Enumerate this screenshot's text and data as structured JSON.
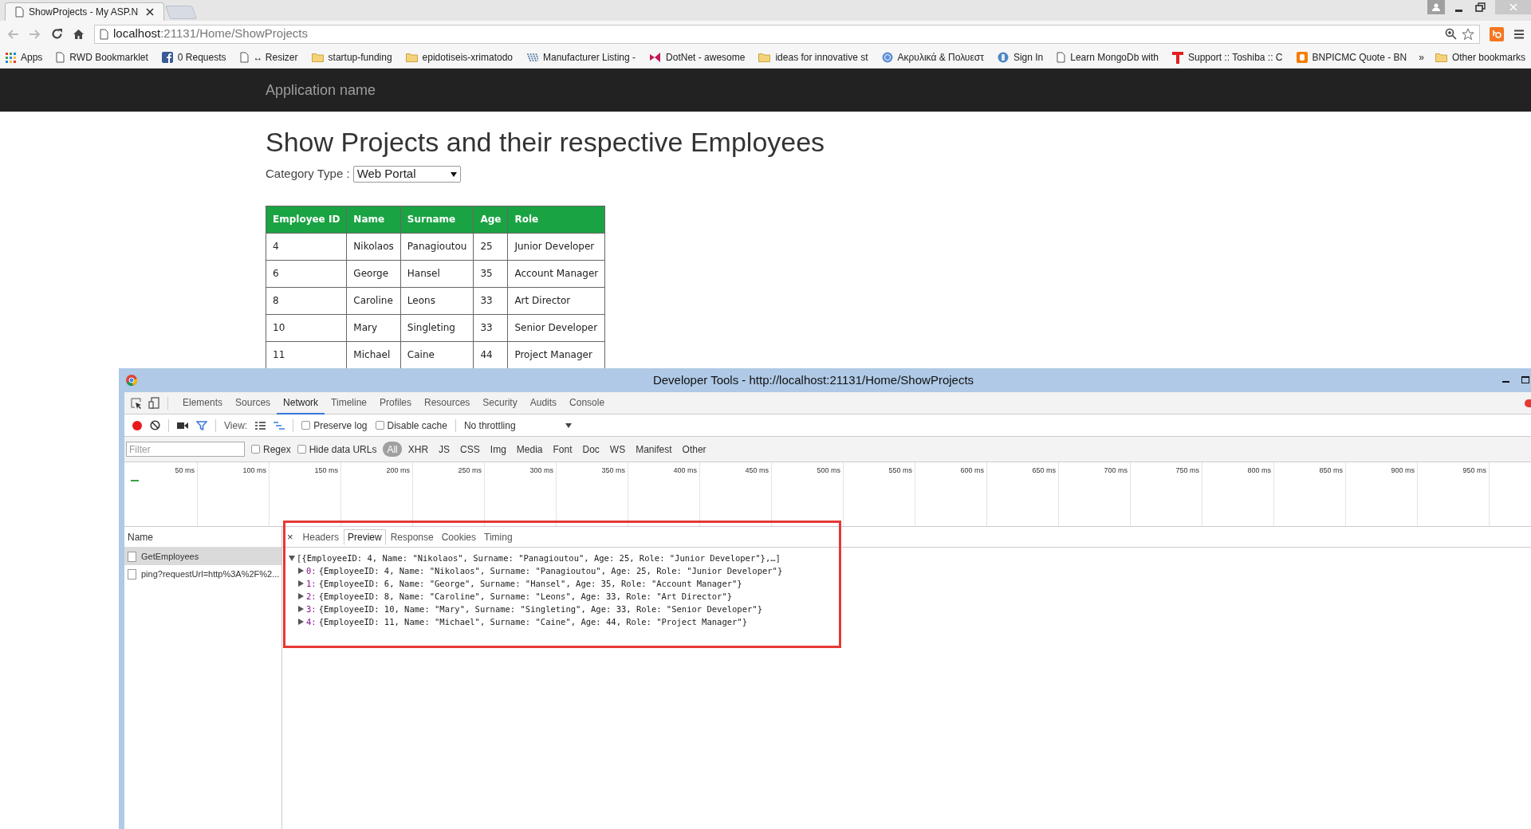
{
  "browser": {
    "tabs": [
      {
        "title": "ShowProjects - My ASP.N",
        "selected": true
      }
    ],
    "address": {
      "host": "localhost",
      "path": ":21131/Home/ShowProjects"
    },
    "bookmarks": [
      {
        "kind": "apps",
        "label": "Apps"
      },
      {
        "kind": "page",
        "label": "RWD Bookmarklet"
      },
      {
        "kind": "facebook",
        "label": "0 Requests"
      },
      {
        "kind": "page",
        "label": "↔ Resizer"
      },
      {
        "kind": "folder",
        "label": "startup-funding"
      },
      {
        "kind": "folder",
        "label": "epidotiseis-xrimatodo"
      },
      {
        "kind": "dots",
        "label": "Manufacturer Listing -"
      },
      {
        "kind": "bowtie",
        "label": "DotNet - awesome"
      },
      {
        "kind": "folder",
        "label": "ideas for innovative st"
      },
      {
        "kind": "globe",
        "label": "Ακρυλικά & Πολυεστ"
      },
      {
        "kind": "badge",
        "label": "Sign In"
      },
      {
        "kind": "page",
        "label": "Learn MongoDb with"
      },
      {
        "kind": "tee",
        "label": "Support :: Toshiba :: C"
      },
      {
        "kind": "orange",
        "label": "BNPICMC Quote - BN"
      }
    ],
    "overflow": "»",
    "other_bookmarks": "Other bookmarks"
  },
  "navbar": {
    "brand": "Application name"
  },
  "page": {
    "heading": "Show Projects and their respective Employees",
    "category": {
      "label": "Category Type :",
      "value": "Web Portal"
    },
    "table": {
      "columns": [
        "Employee ID",
        "Name",
        "Surname",
        "Age",
        "Role"
      ],
      "rows": [
        [
          "4",
          "Nikolaos",
          "Panagioutou",
          "25",
          "Junior Developer"
        ],
        [
          "6",
          "George",
          "Hansel",
          "35",
          "Account Manager"
        ],
        [
          "8",
          "Caroline",
          "Leons",
          "33",
          "Art Director"
        ],
        [
          "10",
          "Mary",
          "Singleting",
          "33",
          "Senior Developer"
        ],
        [
          "11",
          "Michael",
          "Caine",
          "44",
          "Project Manager"
        ]
      ]
    }
  },
  "devtools": {
    "title": "Developer Tools - http://localhost:21131/Home/ShowProjects",
    "panels": [
      {
        "label": "Elements",
        "selected": false
      },
      {
        "label": "Sources",
        "selected": false
      },
      {
        "label": "Network",
        "selected": true
      },
      {
        "label": "Timeline",
        "selected": false
      },
      {
        "label": "Profiles",
        "selected": false
      },
      {
        "label": "Resources",
        "selected": false
      },
      {
        "label": "Security",
        "selected": false
      },
      {
        "label": "Audits",
        "selected": false
      },
      {
        "label": "Console",
        "selected": false
      }
    ],
    "toolbar": {
      "recording": true,
      "view_label": "View:",
      "preserve_log": {
        "label": "Preserve log",
        "checked": false
      },
      "disable_cache": {
        "label": "Disable cache",
        "checked": false
      },
      "throttling": "No throttling"
    },
    "filter": {
      "placeholder": "Filter",
      "regex": {
        "label": "Regex",
        "checked": false
      },
      "hide_data_urls": {
        "label": "Hide data URLs",
        "checked": false
      },
      "types": [
        {
          "label": "All",
          "selected": true
        },
        {
          "label": "XHR",
          "selected": false
        },
        {
          "label": "JS",
          "selected": false
        },
        {
          "label": "CSS",
          "selected": false
        },
        {
          "label": "Img",
          "selected": false
        },
        {
          "label": "Media",
          "selected": false
        },
        {
          "label": "Font",
          "selected": false
        },
        {
          "label": "Doc",
          "selected": false
        },
        {
          "label": "WS",
          "selected": false
        },
        {
          "label": "Manifest",
          "selected": false
        },
        {
          "label": "Other",
          "selected": false
        }
      ]
    },
    "timeline": {
      "ticks": [
        "50 ms",
        "100 ms",
        "150 ms",
        "200 ms",
        "250 ms",
        "300 ms",
        "350 ms",
        "400 ms",
        "450 ms",
        "500 ms",
        "550 ms",
        "600 ms",
        "650 ms",
        "700 ms",
        "750 ms",
        "800 ms",
        "850 ms",
        "900 ms",
        "950 ms"
      ]
    },
    "requests": {
      "header": "Name",
      "items": [
        {
          "name": "GetEmployees",
          "selected": true
        },
        {
          "name": "ping?requestUrl=http%3A%2F%2...",
          "selected": false
        }
      ]
    },
    "detail": {
      "close": "×",
      "tabs": [
        {
          "label": "Headers",
          "selected": false
        },
        {
          "label": "Preview",
          "selected": true
        },
        {
          "label": "Response",
          "selected": false
        },
        {
          "label": "Cookies",
          "selected": false
        },
        {
          "label": "Timing",
          "selected": false
        }
      ],
      "preview": {
        "root": {
          "text": "[{EmployeeID: 4, Name: \"Nikolaos\", Surname: \"Panagioutou\", Age: 25, Role: \"Junior Developer\"},…]",
          "expanded": true
        },
        "items": [
          {
            "index": "0:",
            "text": "{EmployeeID: 4, Name: \"Nikolaos\", Surname: \"Panagioutou\", Age: 25, Role: \"Junior Developer\"}",
            "expanded": false
          },
          {
            "index": "1:",
            "text": "{EmployeeID: 6, Name: \"George\", Surname: \"Hansel\", Age: 35, Role: \"Account Manager\"}",
            "expanded": false
          },
          {
            "index": "2:",
            "text": "{EmployeeID: 8, Name: \"Caroline\", Surname: \"Leons\", Age: 33, Role: \"Art Director\"}",
            "expanded": false
          },
          {
            "index": "3:",
            "text": "{EmployeeID: 10, Name: \"Mary\", Surname: \"Singleting\", Age: 33, Role: \"Senior Developer\"}",
            "expanded": false
          },
          {
            "index": "4:",
            "text": "{EmployeeID: 11, Name: \"Michael\", Surname: \"Caine\", Age: 44, Role: \"Project Manager\"}",
            "expanded": false
          }
        ]
      }
    }
  }
}
